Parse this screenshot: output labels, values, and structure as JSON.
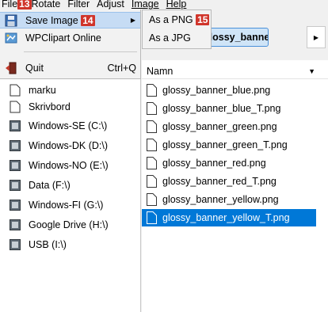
{
  "menubar": {
    "file": "File",
    "file_badge": "13",
    "rotate": "Rotate",
    "filter": "Filter",
    "adjust": "Adjust",
    "image": "Image",
    "help": "Help"
  },
  "file_menu": {
    "save_image": "Save Image",
    "save_badge": "14",
    "wpclipart": "WPClipart Online",
    "quit": "Quit",
    "quit_shortcut": "Ctrl+Q"
  },
  "submenu": {
    "png": "As a PNG",
    "png_badge": "15",
    "jpg": "As a JPG"
  },
  "breadcrumb": {
    "current": "glossy_banner"
  },
  "locations": [
    "marku",
    "Skrivbord",
    "Windows-SE (C:\\)",
    "Windows-DK (D:\\)",
    "Windows-NO (E:\\)",
    "Data (F:\\)",
    "Windows-FI (G:\\)",
    "Google Drive (H:\\)",
    "USB (I:\\)"
  ],
  "file_list": {
    "column_name": "Namn",
    "files": [
      "glossy_banner_blue.png",
      "glossy_banner_blue_T.png",
      "glossy_banner_green.png",
      "glossy_banner_green_T.png",
      "glossy_banner_red.png",
      "glossy_banner_red_T.png",
      "glossy_banner_yellow.png",
      "glossy_banner_yellow_T.png"
    ],
    "selected_index": 7
  },
  "colors": {
    "badge": "#d0352b",
    "selection": "#0078d7",
    "menu_highlight": "#c6dcf4"
  }
}
